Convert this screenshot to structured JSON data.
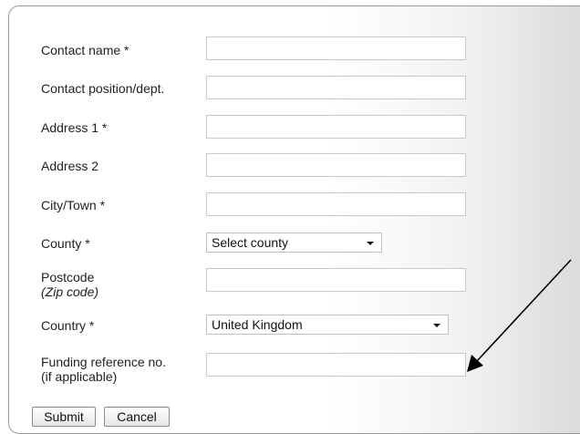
{
  "form": {
    "fields": [
      {
        "label": "Contact name *",
        "value": ""
      },
      {
        "label": "Contact position/dept.",
        "value": ""
      },
      {
        "label": "Address 1 *",
        "value": ""
      },
      {
        "label": "Address 2",
        "value": ""
      },
      {
        "label": "City/Town *",
        "value": ""
      },
      {
        "label": "County *",
        "selected": "Select county"
      },
      {
        "label": "Postcode",
        "hint": "(Zip code)",
        "value": ""
      },
      {
        "label": "Country *",
        "selected": "United Kingdom"
      },
      {
        "label": "Funding reference no.",
        "hint": "(if applicable)",
        "value": ""
      }
    ],
    "buttons": {
      "submit": "Submit",
      "cancel": "Cancel"
    }
  },
  "annotation": {
    "type": "arrow",
    "color": "#000000",
    "points_to": "Funding reference no. input"
  }
}
